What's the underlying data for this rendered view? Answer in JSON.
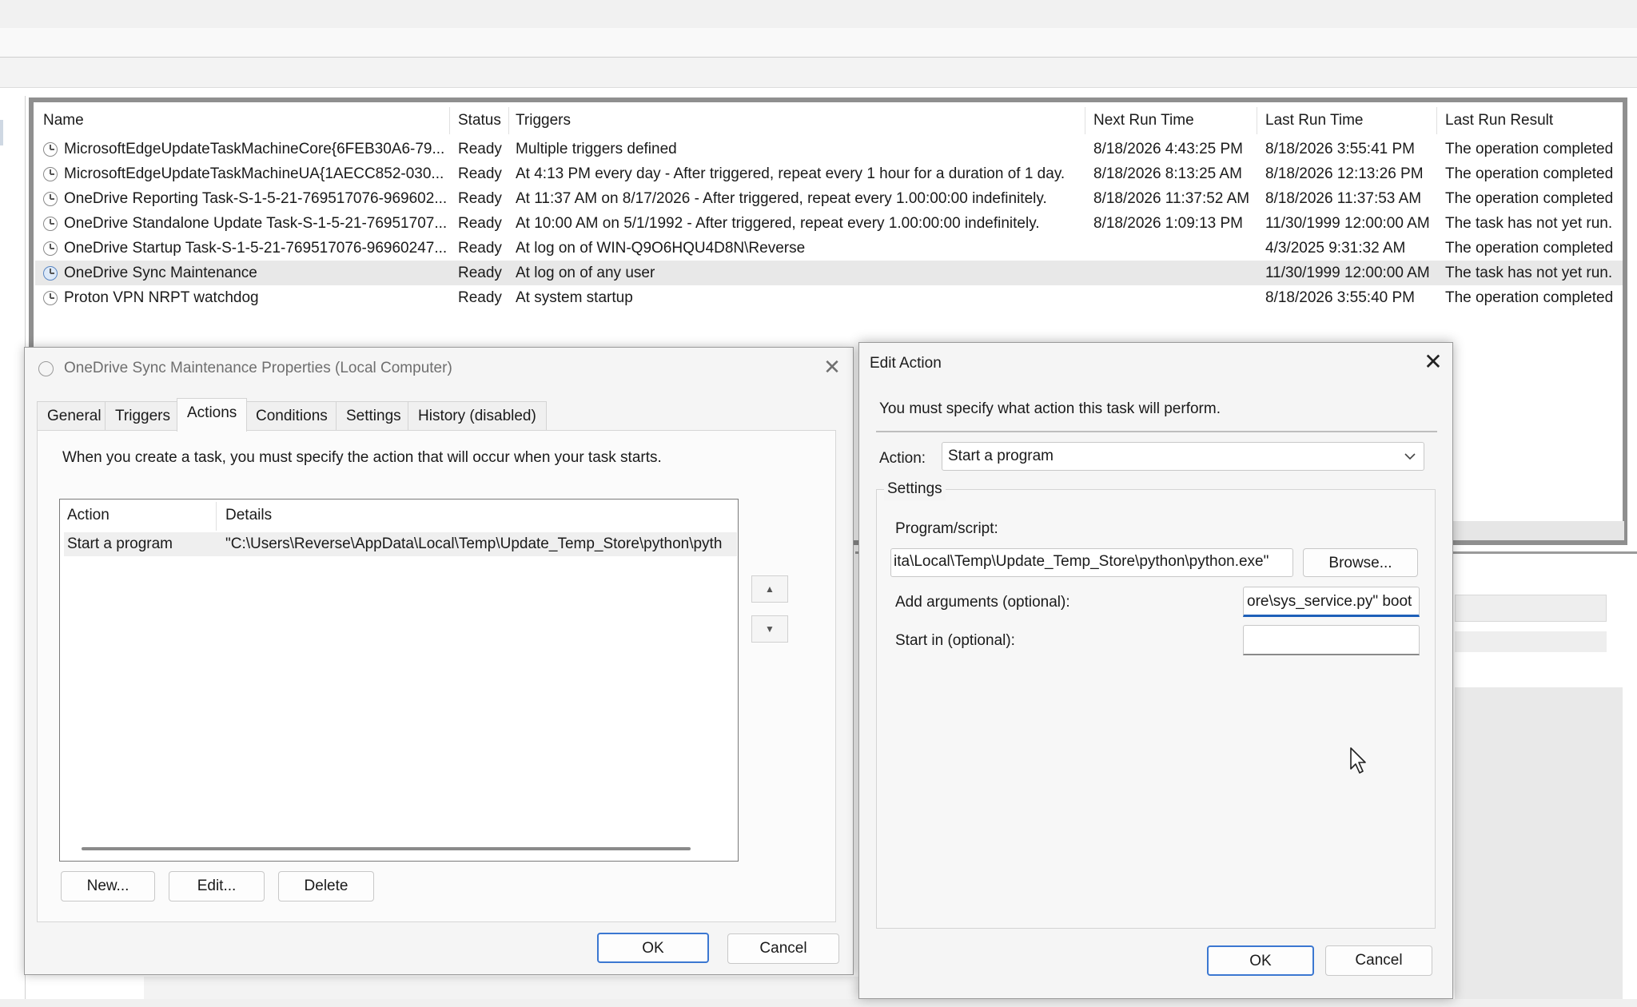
{
  "task_list": {
    "columns": [
      "Name",
      "Status",
      "Triggers",
      "Next Run Time",
      "Last Run Time",
      "Last Run Result"
    ],
    "rows": [
      {
        "name": "MicrosoftEdgeUpdateTaskMachineCore{6FEB30A6-79...",
        "status": "Ready",
        "triggers": "Multiple triggers defined",
        "next_run": "8/18/2026 4:43:25 PM",
        "last_run": "8/18/2026 3:55:41 PM",
        "result": "The operation completed"
      },
      {
        "name": "MicrosoftEdgeUpdateTaskMachineUA{1AECC852-030...",
        "status": "Ready",
        "triggers": "At 4:13 PM every day - After triggered, repeat every 1 hour for a duration of 1 day.",
        "next_run": "8/18/2026 8:13:25 AM",
        "last_run": "8/18/2026 12:13:26 PM",
        "result": "The operation completed"
      },
      {
        "name": "OneDrive Reporting Task-S-1-5-21-769517076-969602...",
        "status": "Ready",
        "triggers": "At 11:37 AM on 8/17/2026 - After triggered, repeat every 1.00:00:00 indefinitely.",
        "next_run": "8/18/2026 11:37:52 AM",
        "last_run": "8/18/2026 11:37:53 AM",
        "result": "The operation completed"
      },
      {
        "name": "OneDrive Standalone Update Task-S-1-5-21-76951707...",
        "status": "Ready",
        "triggers": "At 10:00 AM on 5/1/1992 - After triggered, repeat every 1.00:00:00 indefinitely.",
        "next_run": "8/18/2026 1:09:13 PM",
        "last_run": "11/30/1999 12:00:00 AM",
        "result": "The task has not yet run."
      },
      {
        "name": "OneDrive Startup Task-S-1-5-21-769517076-96960247...",
        "status": "Ready",
        "triggers": "At log on of WIN-Q9O6HQU4D8N\\Reverse",
        "next_run": "",
        "last_run": "4/3/2025 9:31:32 AM",
        "result": "The operation completed"
      },
      {
        "name": "OneDrive Sync Maintenance",
        "status": "Ready",
        "triggers": "At log on of any user",
        "next_run": "",
        "last_run": "11/30/1999 12:00:00 AM",
        "result": "The task has not yet run."
      },
      {
        "name": "Proton VPN NRPT watchdog",
        "status": "Ready",
        "triggers": "At system startup",
        "next_run": "",
        "last_run": "8/18/2026 3:55:40 PM",
        "result": "The operation completed"
      }
    ]
  },
  "properties_dialog": {
    "title": "OneDrive Sync Maintenance Properties (Local Computer)",
    "tabs": [
      "General",
      "Triggers",
      "Actions",
      "Conditions",
      "Settings",
      "History (disabled)"
    ],
    "description": "When you create a task, you must specify the action that will occur when your task starts.",
    "table": {
      "headers": [
        "Action",
        "Details"
      ],
      "row": {
        "action": "Start a program",
        "details": "\"C:\\Users\\Reverse\\AppData\\Local\\Temp\\Update_Temp_Store\\python\\pyth"
      }
    },
    "up_arrow": "▲",
    "down_arrow": "▼",
    "new_label": "New...",
    "edit_label": "Edit...",
    "delete_label": "Delete",
    "ok_label": "OK",
    "cancel_label": "Cancel"
  },
  "edit_action_dialog": {
    "title": "Edit Action",
    "instruction": "You must specify what action this task will perform.",
    "action_label": "Action:",
    "action_value": "Start a program",
    "settings_label": "Settings",
    "program_label": "Program/script:",
    "program_value": "ita\\Local\\Temp\\Update_Temp_Store\\python\\python.exe\"",
    "browse_label": "Browse...",
    "arguments_label": "Add arguments (optional):",
    "arguments_value": "ore\\sys_service.py\" boot",
    "start_in_label": "Start in (optional):",
    "start_in_value": "",
    "ok_label": "OK",
    "cancel_label": "Cancel"
  }
}
